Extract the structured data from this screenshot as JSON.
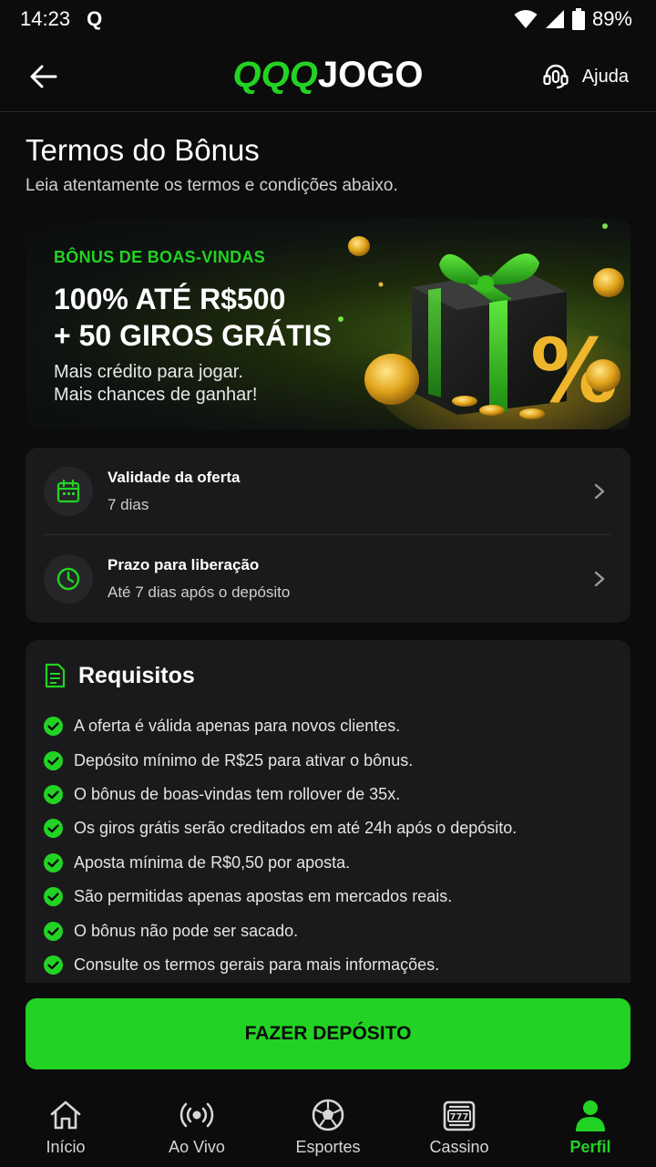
{
  "status_bar": {
    "time": "14:23",
    "notification_icon": "Q",
    "battery": "89%",
    "icons": [
      "wifi-icon",
      "signal-icon",
      "battery-icon"
    ]
  },
  "header": {
    "logo_green": "QQQ",
    "logo_white": "JOGO",
    "help_label": "Ajuda",
    "back_icon": "arrow-left-icon",
    "help_icon": "headset-icon"
  },
  "page": {
    "title": "Termos do Bônus",
    "subtitle": "Leia atentamente os termos e condições abaixo."
  },
  "banner": {
    "kicker": "BÔNUS DE BOAS-VINDAS",
    "headline_line1": "100% ATÉ R$500",
    "headline_line2": "+ 50 GIROS GRÁTIS",
    "desc_line1": "Mais crédito para jogar.",
    "desc_line2": "Mais chances de ganhar!",
    "art": "gift-box-with-coins-and-percent"
  },
  "info": {
    "items": [
      {
        "title": "Validade da oferta",
        "value": "7 dias",
        "icon": "calendar-icon"
      },
      {
        "title": "Prazo para liberação",
        "value": "Até 7 dias após o depósito",
        "icon": "clock-icon"
      }
    ]
  },
  "requirements": {
    "title": "Requisitos",
    "icon": "document-icon",
    "items": [
      "A oferta é válida apenas para novos clientes.",
      "Depósito mínimo de R$25 para ativar o bônus.",
      "O bônus de boas-vindas tem rollover de 35x.",
      "Os giros grátis serão creditados em até 24h após o depósito.",
      "Aposta mínima de R$0,50 por aposta.",
      "São permitidas apenas apostas em mercados reais.",
      "O bônus não pode ser sacado.",
      "Consulte os termos gerais para mais informações."
    ]
  },
  "cta": {
    "label": "FAZER DEPÓSITO"
  },
  "bottom_nav": {
    "items": [
      {
        "label": "Início",
        "icon": "home-icon"
      },
      {
        "label": "Ao Vivo",
        "icon": "live-broadcast-icon"
      },
      {
        "label": "Esportes",
        "icon": "soccer-ball-icon"
      },
      {
        "label": "Cassino",
        "icon": "slot-machine-icon"
      },
      {
        "label": "Perfil",
        "icon": "user-icon",
        "active": true
      }
    ]
  },
  "colors": {
    "accent": "#22d323",
    "background": "#0c0c0d",
    "card": "#1a1a1c"
  }
}
